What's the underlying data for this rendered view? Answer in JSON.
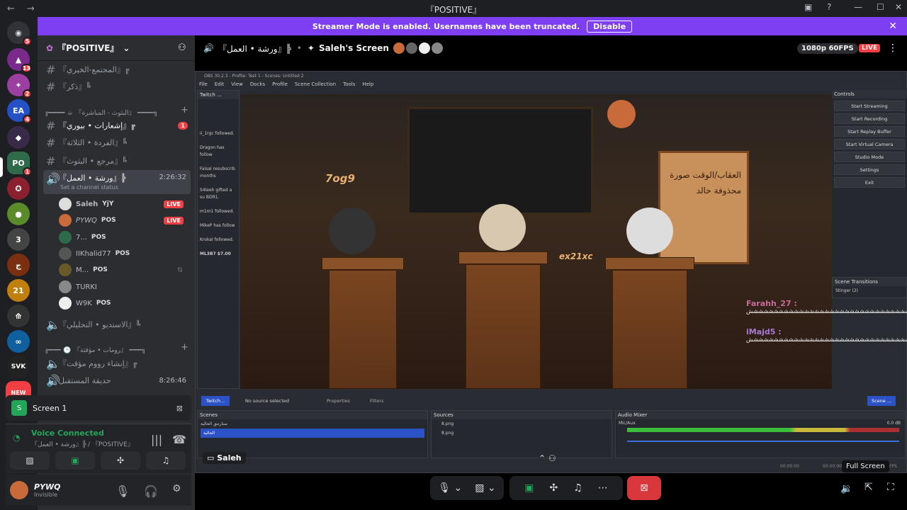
{
  "window": {
    "title": "『POSITIVE』"
  },
  "banner": {
    "message": "Streamer Mode is enabled. Usernames have been truncated.",
    "button_label": "Disable"
  },
  "rail": {
    "badges": [
      "5",
      "13",
      "2",
      "4",
      "1"
    ],
    "labels": [
      "EA",
      "21",
      "SVK",
      "NEW"
    ]
  },
  "server": {
    "name": "『POSITIVE』"
  },
  "channels": [
    {
      "name": "『المجتمع-الخيري』╔",
      "type": "text"
    },
    {
      "name": "『ذكر』╚",
      "type": "text"
    },
    {
      "name": "╔━━━━ ☕ 『البثوث - المباشرة』 ━━━━╗",
      "type": "category"
    },
    {
      "name": "『إشعارات • بيوري』╔",
      "type": "text",
      "badge": "1"
    },
    {
      "name": "『الفردة • الثلاثة』╚",
      "type": "text"
    },
    {
      "name": "『مرجع • البثوث』╚",
      "type": "text"
    },
    {
      "name": "『ورشة • العمل』╠",
      "type": "voice",
      "timer": "2:26:32"
    }
  ],
  "channel_status": "Set a channel status",
  "voice_users": [
    {
      "name": "Saleh",
      "tag": "YjY",
      "live": "LIVE"
    },
    {
      "name": "PYWQ",
      "tag": "POS",
      "live": "LIVE"
    },
    {
      "name": "7...",
      "tag": "POS"
    },
    {
      "name": "IIKhalid77",
      "tag": "POS"
    },
    {
      "name": "M...",
      "tag": "POS"
    },
    {
      "name": "TURKI",
      "tag": ""
    },
    {
      "name": "W9K",
      "tag": "POS"
    }
  ],
  "channels2": [
    {
      "name": "『الاستديو • التحليلي』╚",
      "type": "voice"
    },
    {
      "name": "╔━━━ 🕒 『رومات • مؤقتة』 ━━━╗",
      "type": "category"
    },
    {
      "name": "『إنشاء رووم مؤقت』╔",
      "type": "voice"
    },
    {
      "name": "حديقة المستقبل",
      "type": "voice",
      "timer": "8:26:46"
    }
  ],
  "screen_panel": {
    "label": "Screen 1"
  },
  "voice_panel": {
    "status": "Voice Connected",
    "location": "『ورشة • العمل』╠ / 『POSITIVE』"
  },
  "user_panel": {
    "name": "PYWQ",
    "status": "Invisible"
  },
  "stream_header": {
    "channel": "『ورشة • العمل』╠",
    "title": "Saleh's Screen",
    "quality": "1080p 60FPS",
    "live": "LIVE"
  },
  "obs": {
    "title": "OBS 30.2.3 - Profile: Test 1 - Scenes: Untitled 2",
    "menu": [
      "File",
      "Edit",
      "View",
      "Docks",
      "Profile",
      "Scene Collection",
      "Tools",
      "Help"
    ],
    "controls_title": "Controls",
    "controls": [
      "Start Streaming",
      "Start Recording",
      "Start Replay Buffer",
      "Start Virtual Camera",
      "Studio Mode",
      "Settings",
      "Exit"
    ],
    "transitions_title": "Scene Transitions",
    "transition_value": "Stinger (2)",
    "chat_dock": "Twitch ...",
    "chat_entries": [
      "ii_1rgc followed.",
      "Dragon has follow",
      "Faisal resubscrib months",
      "S4leeh gifted a su BDR1.",
      "m1m1 followed.",
      "MikeP has follow",
      "Krokal followed.",
      "ML3B7 $7.00"
    ],
    "scenes_title": "Scenes",
    "scenes": [
      "ستارتنق الحالية",
      "الحالية"
    ],
    "sources_title": "Sources",
    "sources": [
      "8.png",
      "8.png"
    ],
    "mixer_title": "Audio Mixer",
    "mixer_channel": "Mic/Aux",
    "mixer_db": "0.0 dB",
    "no_source": "No source selected",
    "properties": "Properties",
    "filters": "Filters",
    "twitch_tab": "Twitch...",
    "scene_tab": "Scene ...",
    "status_fps": "60.00 FPS",
    "status_time1": "00:00:00",
    "status_time2": "00:00:00",
    "preview_labels": [
      "7og9",
      "ex21xc"
    ],
    "board_text": "العقاب/الوقت صورة محذوفة خالد"
  },
  "chat_overlay": [
    {
      "name": "Farahh_27 :",
      "msg": "ششششششششششششششششششششششششششششششششششش"
    },
    {
      "name": "iMajd5 :",
      "msg": "شششششششششششششششششششششششششششششششششششششششششششش"
    }
  ],
  "overlay_name": "Saleh",
  "fullscreen_label": "Full Screen"
}
